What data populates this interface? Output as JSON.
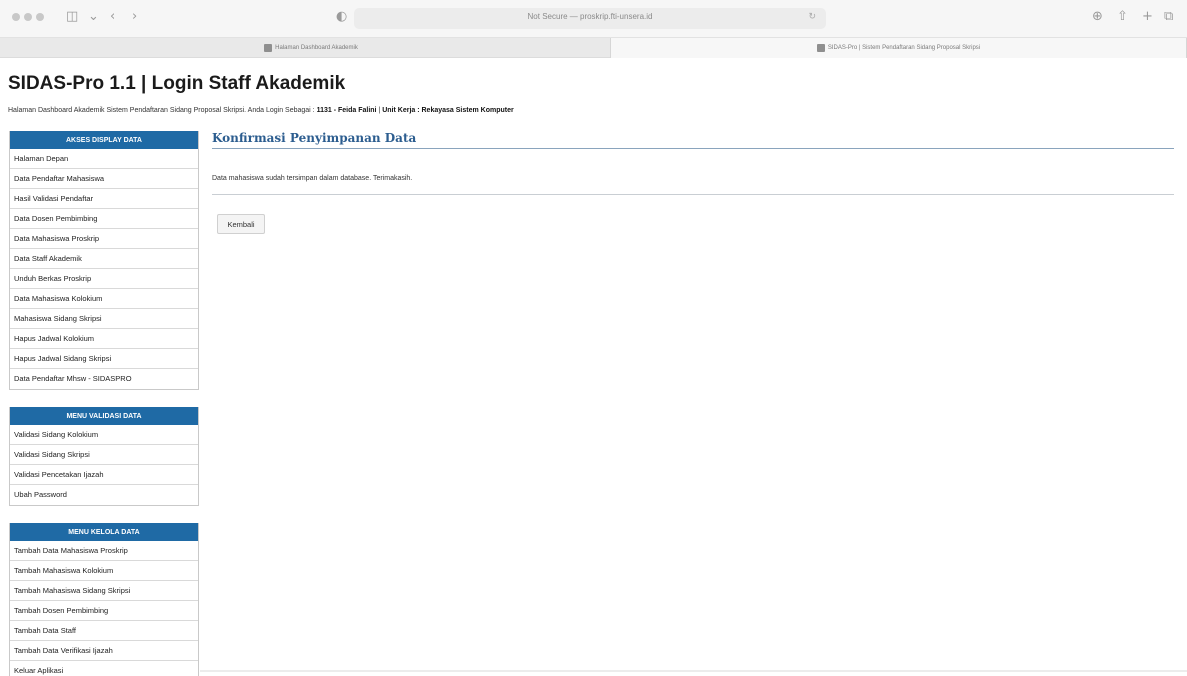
{
  "browser": {
    "address": "Not Secure — proskrip.fti-unsera.id",
    "tabs": [
      {
        "label": "Halaman Dashboard Akademik",
        "active": false
      },
      {
        "label": "SIDAS-Pro | Sistem Pendaftaran Sidang Proposal Skripsi",
        "active": true
      }
    ]
  },
  "page": {
    "title": "SIDAS-Pro 1.1 | Login Staff Akademik",
    "login_prefix": "Halaman Dashboard Akademik Sistem Pendaftaran Sidang Proposal Skripsi. Anda Login Sebagai : ",
    "login_user": "1131 - Feida Falini",
    "login_sep": " | ",
    "login_unit": "Unit Kerja : Rekayasa Sistem Komputer"
  },
  "sidebar": {
    "display": {
      "title": "AKSES DISPLAY DATA",
      "items": [
        "Halaman Depan",
        "Data Pendaftar Mahasiswa",
        "Hasil Validasi Pendaftar",
        "Data Dosen Pembimbing",
        "Data Mahasiswa Proskrip",
        "Data Staff Akademik",
        "Unduh Berkas Proskrip",
        "Data Mahasiswa Kolokium",
        "Mahasiswa Sidang Skripsi",
        "Hapus Jadwal Kolokium",
        "Hapus Jadwal Sidang Skripsi",
        "Data Pendaftar Mhsw - SIDASPRO"
      ]
    },
    "validasi": {
      "title": "MENU VALIDASI DATA",
      "items": [
        "Validasi Sidang Kolokium",
        "Validasi Sidang Skripsi",
        "Validasi Pencetakan Ijazah",
        "Ubah Password"
      ]
    },
    "kelola": {
      "title": "MENU KELOLA DATA",
      "items": [
        "Tambah Data Mahasiswa Proskrip",
        "Tambah Mahasiswa Kolokium",
        "Tambah Mahasiswa Sidang Skripsi",
        "Tambah Dosen Pembimbing",
        "Tambah Data Staff",
        "Tambah Data Verifikasi Ijazah",
        "Keluar Aplikasi"
      ]
    }
  },
  "content": {
    "heading": "Konfirmasi Penyimpanan Data",
    "message": "Data mahasiswa sudah tersimpan dalam database. Terimakasih.",
    "back_label": "Kembali"
  },
  "colors": {
    "menu_header": "#1f6aa5",
    "heading": "#2c5d8f"
  }
}
